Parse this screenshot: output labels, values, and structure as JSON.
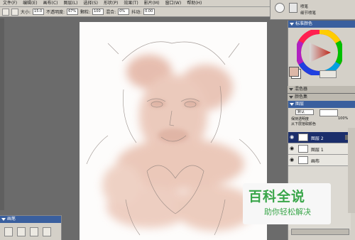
{
  "menubar": {
    "items": [
      "文件(F)",
      "编辑(E)",
      "画布(C)",
      "图层(L)",
      "选择(S)",
      "形状(P)",
      "效果(T)",
      "影片(M)",
      "窗口(W)",
      "帮助(H)"
    ]
  },
  "propbar": {
    "size_label": "大小:",
    "size_value": "15.0",
    "opacity_label": "不透明度:",
    "opacity_value": "67%",
    "grain_label": "颗粒:",
    "grain_value": "100",
    "blend_label": "混合:",
    "blend_value": "0%",
    "bleed_label": "抖动:",
    "bleed_value": "0.00"
  },
  "brush_selector": {
    "category": "喷笔",
    "variant": "细节喷笔"
  },
  "color_panel": {
    "title": "标准颜色",
    "wheel_note": "color-wheel",
    "swatch_main": "#ddb8a8",
    "swatch_back": "#ffffff"
  },
  "mixer_panels": [
    {
      "title": "混色器"
    },
    {
      "title": "颜色集"
    }
  ],
  "layer_panel": {
    "title": "图层",
    "composite_method": "默认",
    "preserve_label": "保持透明度",
    "pick_label": "从下层拾取颜色",
    "opacity_value": "100%",
    "layers": [
      {
        "name": "图层 2",
        "selected": true
      },
      {
        "name": "图层 1",
        "selected": false
      },
      {
        "name": "画布",
        "selected": false
      }
    ]
  },
  "brush_panel": {
    "title": "画笔"
  },
  "watermark": {
    "logo": "百科全说",
    "sub": "助你轻松解决"
  },
  "colors": {
    "chrome": "#d4d0c8",
    "panel_title": "#3a5f9e",
    "selected_layer": "#1b2e6b",
    "skin": "#e5b8a8",
    "watermark_green": "#3aa64a"
  }
}
